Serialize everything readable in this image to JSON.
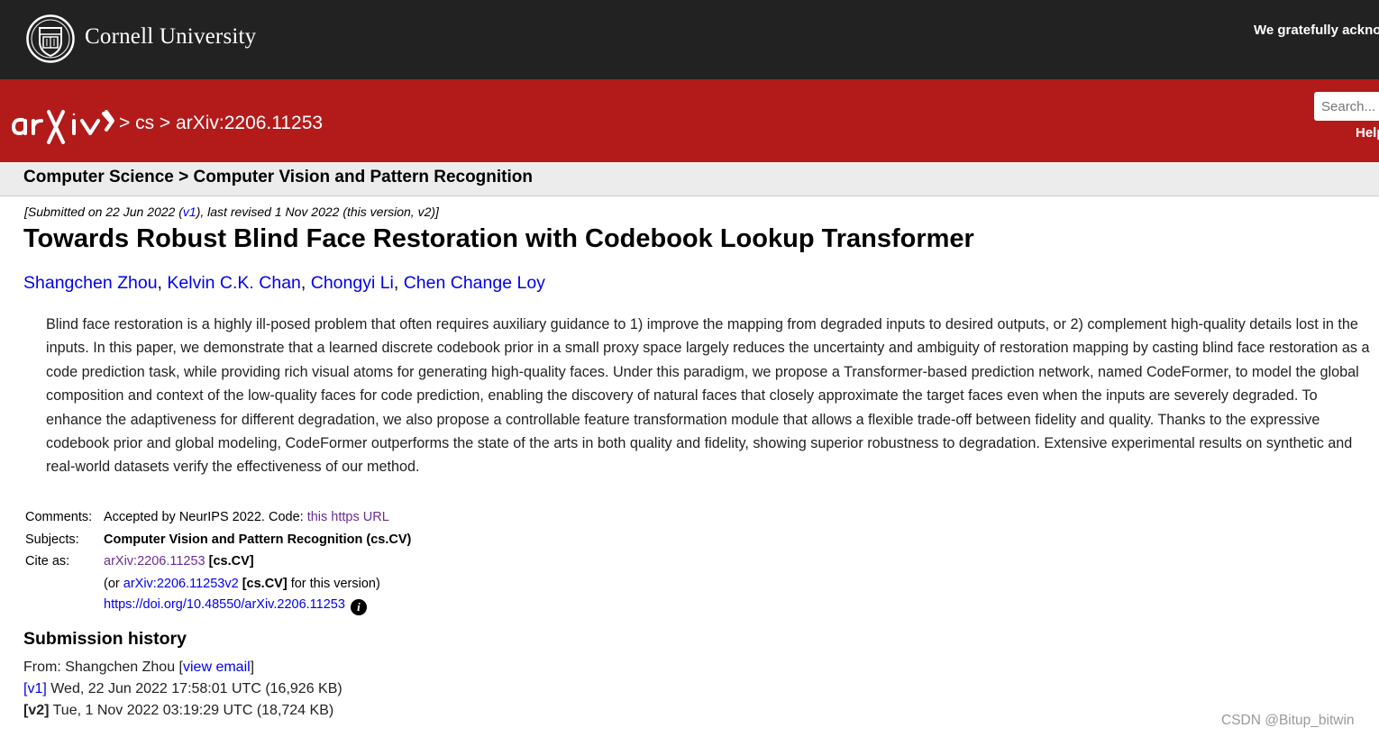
{
  "header": {
    "university": "Cornell University",
    "acknowledgement": "We gratefully acknov"
  },
  "nav": {
    "breadcrumb": "> cs > arXiv:2206.11253",
    "search_placeholder": "Search...",
    "help_label": "Help"
  },
  "subject_breadcrumb": "Computer Science > Computer Vision and Pattern Recognition",
  "dateline": {
    "prefix": "[Submitted on 22 Jun 2022 (",
    "v1_link": "v1",
    "suffix": "), last revised 1 Nov 2022 (this version, v2)]"
  },
  "paper": {
    "title": "Towards Robust Blind Face Restoration with Codebook Lookup Transformer",
    "authors": [
      "Shangchen Zhou",
      "Kelvin C.K. Chan",
      "Chongyi Li",
      "Chen Change Loy"
    ],
    "author_separator": ", ",
    "abstract": "Blind face restoration is a highly ill-posed problem that often requires auxiliary guidance to 1) improve the mapping from degraded inputs to desired outputs, or 2) complement high-quality details lost in the inputs. In this paper, we demonstrate that a learned discrete codebook prior in a small proxy space largely reduces the uncertainty and ambiguity of restoration mapping by casting blind face restoration as a code prediction task, while providing rich visual atoms for generating high-quality faces. Under this paradigm, we propose a Transformer-based prediction network, named CodeFormer, to model the global composition and context of the low-quality faces for code prediction, enabling the discovery of natural faces that closely approximate the target faces even when the inputs are severely degraded. To enhance the adaptiveness for different degradation, we also propose a controllable feature transformation module that allows a flexible trade-off between fidelity and quality. Thanks to the expressive codebook prior and global modeling, CodeFormer outperforms the state of the arts in both quality and fidelity, showing superior robustness to degradation. Extensive experimental results on synthetic and real-world datasets verify the effectiveness of our method."
  },
  "metadata": {
    "comments_label": "Comments:",
    "comments_text": "Accepted by NeurIPS 2022. Code: ",
    "comments_link": "this https URL",
    "subjects_label": "Subjects:",
    "subjects_value": "Computer Vision and Pattern Recognition (cs.CV)",
    "cite_label": "Cite as:",
    "cite_link": "arXiv:2206.11253",
    "cite_tag": "[cs.CV]",
    "cite_version_prefix": "(or ",
    "cite_version_link": "arXiv:2206.11253v2",
    "cite_version_tag": "[cs.CV]",
    "cite_version_suffix": " for this version)",
    "doi_link": "https://doi.org/10.48550/arXiv.2206.11253",
    "info_glyph": "i"
  },
  "history": {
    "heading": "Submission history",
    "from_prefix": "From: Shangchen Zhou [",
    "email_link": "view email",
    "from_suffix": "]",
    "versions": [
      {
        "label": "[v1]",
        "is_link": true,
        "text": " Wed, 22 Jun 2022 17:58:01 UTC (16,926 KB)"
      },
      {
        "label": "[v2]",
        "is_link": false,
        "text": " Tue, 1 Nov 2022 03:19:29 UTC (18,724 KB)"
      }
    ]
  },
  "watermark": "CSDN @Bitup_bitwin",
  "colors": {
    "top_bar": "#222222",
    "arxiv_red": "#b31b1b",
    "link_blue": "#0000ee",
    "visited_purple": "#6a2d91"
  },
  "icons": [
    "cornell-seal-icon",
    "arxiv-logo-icon",
    "info-icon"
  ]
}
